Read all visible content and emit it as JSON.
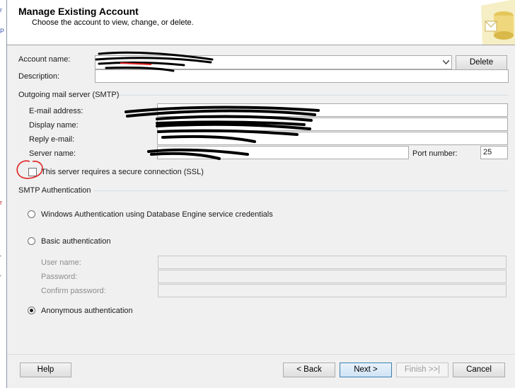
{
  "header": {
    "title": "Manage Existing Account",
    "subtitle": "Choose the account to view, change, or delete."
  },
  "account": {
    "name_label": "Account name:",
    "description_label": "Description:",
    "delete_label": "Delete"
  },
  "smtp": {
    "group_title": "Outgoing mail server (SMTP)",
    "email_label": "E-mail address:",
    "display_label": "Display name:",
    "reply_label": "Reply e-mail:",
    "server_label": "Server name:",
    "port_label": "Port number:",
    "port_value": "25",
    "ssl_label": "This server requires a secure connection (SSL)"
  },
  "auth": {
    "group_title": "SMTP Authentication",
    "windows_label": "Windows Authentication using Database Engine service credentials",
    "basic_label": "Basic authentication",
    "user_label": "User name:",
    "password_label": "Password:",
    "confirm_label": "Confirm password:",
    "anonymous_label": "Anonymous authentication",
    "selected": "anonymous"
  },
  "footer": {
    "help_label": "Help",
    "back_label": "< Back",
    "next_label": "Next >",
    "finish_label": "Finish >>|",
    "cancel_label": "Cancel"
  },
  "colors": {
    "scribble": "#000000",
    "annotation_circle": "#e02020",
    "red_mark": "#e02020"
  }
}
